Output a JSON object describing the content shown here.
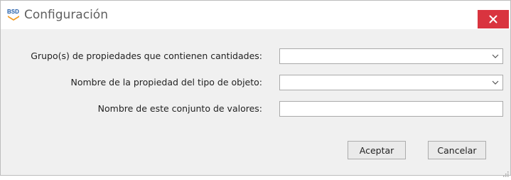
{
  "window": {
    "title": "Configuración",
    "app_icon": "bsd-logo-icon",
    "close_icon": "close-icon"
  },
  "form": {
    "fields": [
      {
        "label": "Grupo(s) de propiedades que contienen cantidades:",
        "type": "combobox",
        "value": ""
      },
      {
        "label": "Nombre de la propiedad del tipo de objeto:",
        "type": "combobox",
        "value": ""
      },
      {
        "label": "Nombre de este conjunto de valores:",
        "type": "text",
        "value": ""
      }
    ]
  },
  "buttons": {
    "accept_label": "Aceptar",
    "cancel_label": "Cancelar"
  },
  "colors": {
    "close_button": "#d9343f",
    "logo_orange": "#f29a1f",
    "logo_blue": "#1e5ba8"
  }
}
